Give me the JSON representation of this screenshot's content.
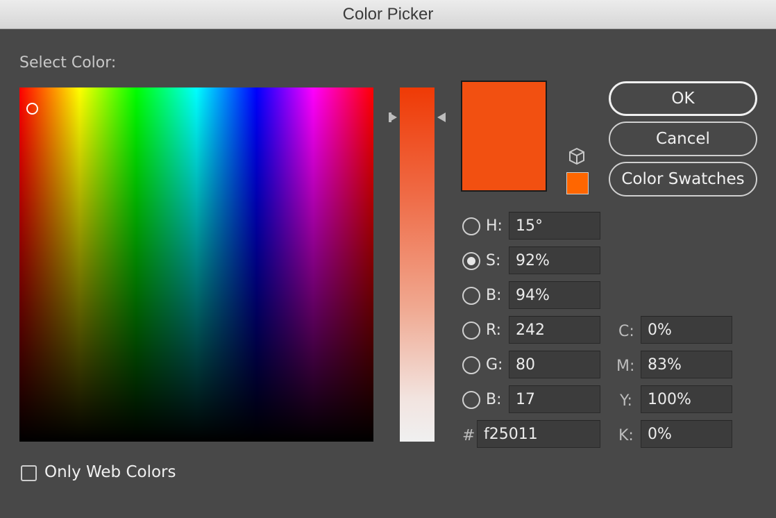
{
  "window": {
    "title": "Color Picker"
  },
  "picker": {
    "select_label": "Select Color:",
    "current_color": "#f25011",
    "websafe_color": "#ff6600"
  },
  "buttons": {
    "ok": "OK",
    "cancel": "Cancel",
    "swatches": "Color Swatches"
  },
  "hsb": [
    {
      "label": "H:",
      "value": "15°",
      "checked": false
    },
    {
      "label": "S:",
      "value": "92%",
      "checked": true
    },
    {
      "label": "B:",
      "value": "94%",
      "checked": false
    }
  ],
  "rgb": [
    {
      "label": "R:",
      "value": "242",
      "checked": false
    },
    {
      "label": "G:",
      "value": "80",
      "checked": false
    },
    {
      "label": "B:",
      "value": "17",
      "checked": false
    }
  ],
  "hex": {
    "label": "#",
    "value": "f25011"
  },
  "cmyk": [
    {
      "label": "C:",
      "value": "0%"
    },
    {
      "label": "M:",
      "value": "83%"
    },
    {
      "label": "Y:",
      "value": "100%"
    },
    {
      "label": "K:",
      "value": "0%"
    }
  ],
  "options": {
    "only_web_colors": "Only Web Colors",
    "only_web_checked": false
  },
  "icons": {
    "gamut_warning": "cube-icon"
  }
}
